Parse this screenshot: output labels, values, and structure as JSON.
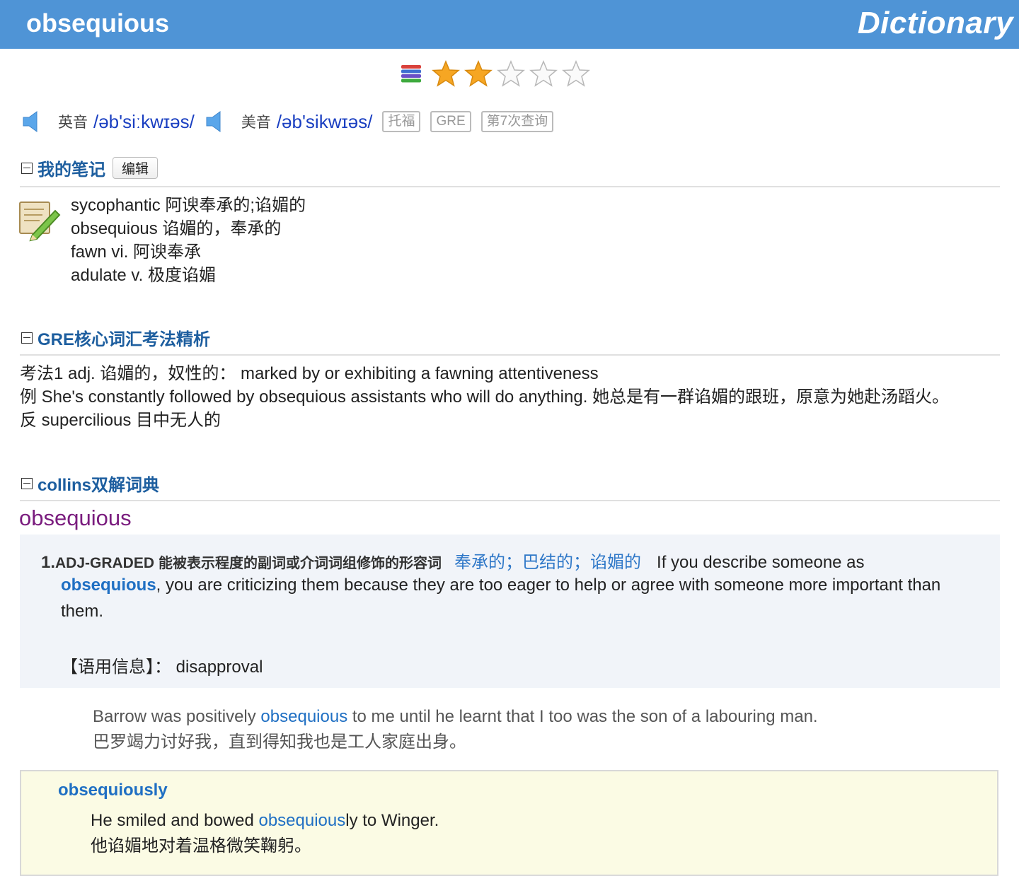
{
  "header": {
    "word": "obsequious",
    "brand": "Dictionary"
  },
  "rating": {
    "stars_filled": 2,
    "stars_total": 5,
    "icon": "frequency-bars-icon"
  },
  "pronunciation": {
    "uk_label": "英音",
    "uk_phonetic": "/əb'siːkwɪəs/",
    "us_label": "美音",
    "us_phonetic": "/əb'sikwɪəs/",
    "tags": [
      "托福",
      "GRE",
      "第7次查询"
    ]
  },
  "notes": {
    "title": "我的笔记",
    "edit_label": "编辑",
    "lines": [
      "sycophantic 阿谀奉承的;谄媚的",
      "obsequious 谄媚的，奉承的",
      "fawn vi. 阿谀奉承",
      "adulate v. 极度谄媚"
    ]
  },
  "gre": {
    "title": "GRE核心词汇考法精析",
    "lines": [
      "考法1 adj. 谄媚的，奴性的：  marked by or exhibiting a fawning attentiveness",
      "例 She's constantly followed by obsequious assistants who will do anything. 她总是有一群谄媚的跟班，原意为她赴汤蹈火。",
      "反 supercilious 目中无人的"
    ]
  },
  "collins": {
    "title": "collins双解词典",
    "headword": "obsequious",
    "sense": {
      "number": "1.",
      "pos": "ADJ-GRADED",
      "pos_cn": "能被表示程度的副词或介词词组修饰的形容词",
      "cn": "奉承的；巴结的；谄媚的",
      "en_start": "If you describe someone as",
      "en_word": "obsequious",
      "en_rest": ", you are criticizing them because they are too eager to help or agree with someone more important than",
      "en_end": "them.",
      "usage_label": "【语用信息】：",
      "usage_value": "disapproval"
    },
    "example": {
      "en_before": "Barrow was positively ",
      "en_word": "obsequious",
      "en_after": " to me until he learnt that I too was the son of a labouring man.",
      "cn": "巴罗竭力讨好我，直到得知我也是工人家庭出身。"
    },
    "derivative": {
      "word": "obsequiously",
      "ex_before": "He smiled and bowed ",
      "ex_word": "obsequious",
      "ex_after": "ly to Winger.",
      "cn": "他谄媚地对着温格微笑鞠躬。"
    }
  }
}
